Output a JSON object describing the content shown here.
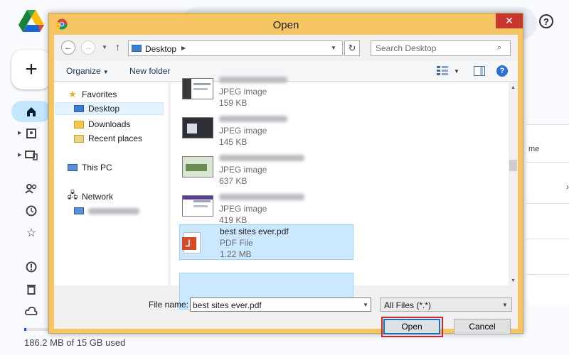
{
  "background": {
    "storage_text": "186.2 MB of 15 GB used",
    "right_panel_text": "me"
  },
  "dialog": {
    "title": "Open",
    "close_glyph": "✕",
    "address": {
      "crumb": "Desktop"
    },
    "search": {
      "placeholder": "Search Desktop"
    },
    "toolbar": {
      "organize_label": "Organize",
      "new_folder_label": "New folder"
    },
    "nav_pane": {
      "favorites_label": "Favorites",
      "desktop_label": "Desktop",
      "downloads_label": "Downloads",
      "recent_label": "Recent places",
      "this_pc_label": "This PC",
      "network_label": "Network"
    },
    "files": [
      {
        "type": "JPEG image",
        "size": "159 KB"
      },
      {
        "type": "JPEG image",
        "size": "145 KB"
      },
      {
        "type": "JPEG image",
        "size": "637 KB"
      },
      {
        "type": "JPEG image",
        "size": "419 KB"
      },
      {
        "name": "best sites ever.pdf",
        "type": "PDF File",
        "size": "1.22 MB"
      }
    ],
    "file_name_label": "File name:",
    "file_name_value": "best sites ever.pdf",
    "file_type_value": "All Files (*.*)",
    "open_button": "Open",
    "cancel_button": "Cancel"
  },
  "colors": {
    "title_bar": "#f6c563",
    "close_button": "#c7372f",
    "selection": "#cce8ff",
    "highlight_box": "#d6242a"
  },
  "icons": [
    "drive-logo",
    "plus-icon",
    "home-icon",
    "shared-drive-icon",
    "computer-icon",
    "people-icon",
    "clock-icon",
    "star-icon",
    "spam-icon",
    "trash-icon",
    "cloud-icon",
    "help-icon",
    "chrome-icon",
    "back-icon",
    "forward-icon",
    "up-icon",
    "refresh-icon",
    "search-icon",
    "pdf-icon"
  ]
}
